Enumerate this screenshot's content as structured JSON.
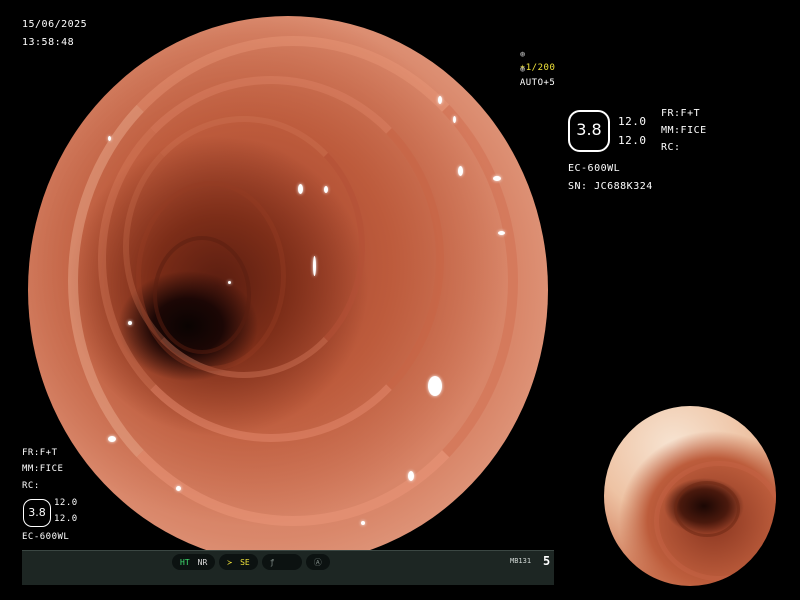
{
  "header": {
    "date": "15/06/2025",
    "time": "13:58:48"
  },
  "exposure": {
    "shutter": "1/200",
    "auto": "AUTO+5",
    "shutter_color": "#f2e43a"
  },
  "right_panel": {
    "badge_value": "3.8",
    "value_top": "12.0",
    "value_bottom": "12.0",
    "fr": "FR:F+T",
    "mm": "MM:FICE",
    "rc": "RC:",
    "scope_model": "EC-600WL",
    "serial": "SN: JC688K324"
  },
  "left_panel": {
    "fr": "FR:F+T",
    "mm": "MM:FICE",
    "rc": "RC:",
    "badge_value": "3.8",
    "value_top": "12.0",
    "value_bottom": "12.0",
    "scope_model": "EC-600WL"
  },
  "status_bar": {
    "ht": "HT",
    "nr": "NR",
    "se": "SE",
    "mb_code": "MB131",
    "page": "5",
    "ht_color": "#3fe070",
    "se_color": "#f2e43a"
  },
  "icons": {
    "shutter": "gear-icon",
    "auto": "gear-icon",
    "sharpen": "sharpen-icon",
    "freeze": "slash-icon",
    "alert": "warning-circle-icon"
  }
}
